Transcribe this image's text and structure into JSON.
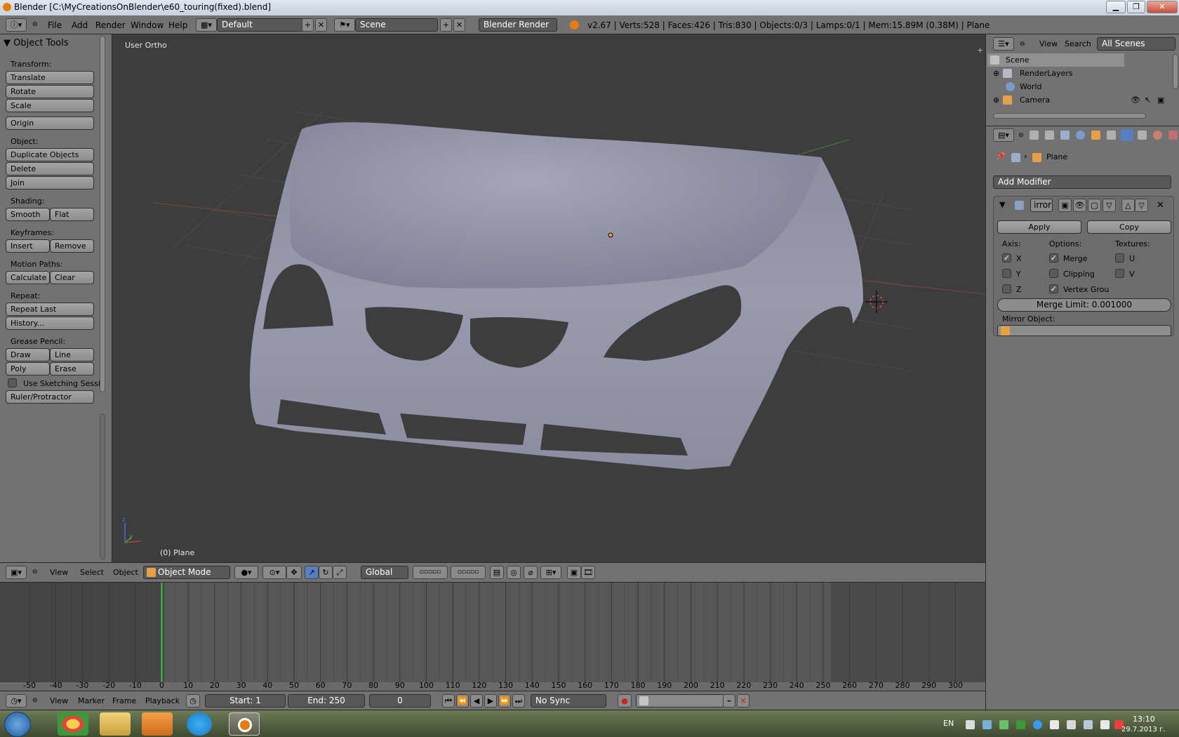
{
  "window": {
    "title": "Blender [C:\\MyCreationsOnBlender\\e60_touring(fixed).blend]"
  },
  "menubar": {
    "menus": [
      "File",
      "Add",
      "Render",
      "Window",
      "Help"
    ],
    "screen_layout": "Default",
    "scene": "Scene",
    "engine": "Blender Render",
    "stats": "v2.67 | Verts:528 | Faces:426 | Tris:830 | Objects:0/3 | Lamps:0/1 | Mem:15.89M (0.38M) | Plane"
  },
  "tools": {
    "title": "Object Tools",
    "transform_label": "Transform:",
    "translate": "Translate",
    "rotate": "Rotate",
    "scale": "Scale",
    "origin": "Origin",
    "object_label": "Object:",
    "duplicate": "Duplicate Objects",
    "delete": "Delete",
    "join": "Join",
    "shading_label": "Shading:",
    "smooth": "Smooth",
    "flat": "Flat",
    "keyframes_label": "Keyframes:",
    "insert": "Insert",
    "remove": "Remove",
    "motion_label": "Motion Paths:",
    "calculate": "Calculate",
    "clear": "Clear",
    "repeat_label": "Repeat:",
    "repeat_last": "Repeat Last",
    "history": "History...",
    "grease_label": "Grease Pencil:",
    "draw": "Draw",
    "line": "Line",
    "poly": "Poly",
    "erase": "Erase",
    "sketching": "Use Sketching Sessi",
    "ruler": "Ruler/Protractor"
  },
  "viewport": {
    "view_label": "User Ortho",
    "object_label": "(0) Plane"
  },
  "vpheader": {
    "view": "View",
    "select": "Select",
    "object": "Object",
    "mode": "Object Mode",
    "orientation": "Global"
  },
  "timeline": {
    "ticks": [
      "-50",
      "-40",
      "-30",
      "-20",
      "-10",
      "0",
      "10",
      "20",
      "30",
      "40",
      "50",
      "60",
      "70",
      "80",
      "90",
      "100",
      "110",
      "120",
      "130",
      "140",
      "150",
      "160",
      "170",
      "180",
      "190",
      "200",
      "210",
      "220",
      "230",
      "240",
      "250",
      "260",
      "270",
      "280",
      "290",
      "300"
    ],
    "view": "View",
    "marker": "Marker",
    "frame": "Frame",
    "playback": "Playback",
    "start": "Start: 1",
    "end": "End: 250",
    "current": "0",
    "sync": "No Sync"
  },
  "outliner": {
    "view": "View",
    "search": "Search",
    "filter": "All Scenes",
    "rows": [
      "Scene",
      "RenderLayers",
      "World",
      "Camera"
    ]
  },
  "properties": {
    "breadcrumb_object": "Plane",
    "add_modifier": "Add Modifier",
    "modifier_name": "irror",
    "apply": "Apply",
    "copy": "Copy",
    "axis_label": "Axis:",
    "options_label": "Options:",
    "textures_label": "Textures:",
    "x": "X",
    "y": "Y",
    "z": "Z",
    "merge": "Merge",
    "clipping": "Clipping",
    "vertex_groups": "Vertex Grou",
    "u": "U",
    "v": "V",
    "merge_limit": "Merge Limit: 0.001000",
    "mirror_object_label": "Mirror Object:"
  },
  "taskbar": {
    "lang": "EN",
    "time": "13:10",
    "date": "29.7.2013 г."
  }
}
